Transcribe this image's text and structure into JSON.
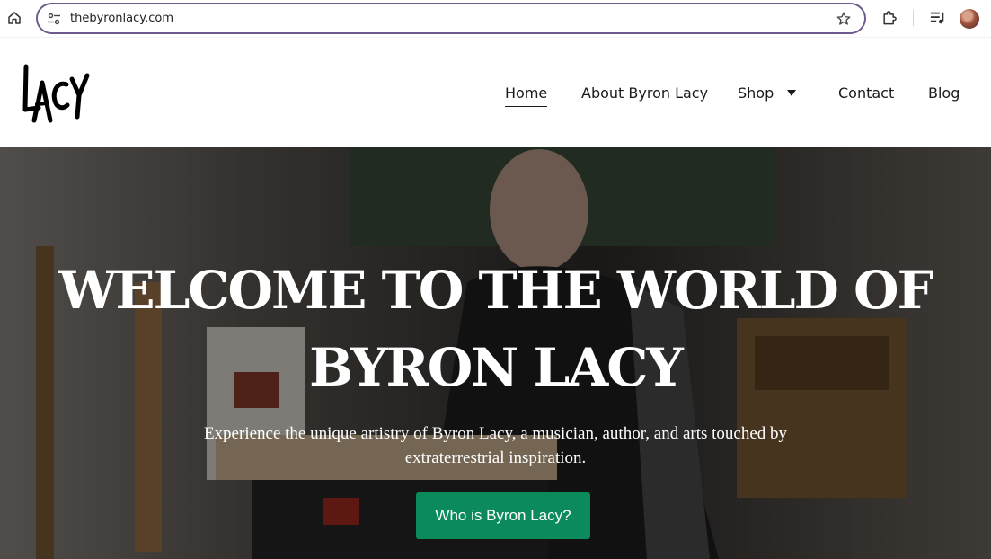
{
  "browser": {
    "url": "thebyronlacy.com",
    "icons": {
      "home": "home-icon",
      "site_settings": "tune-icon",
      "bookmark": "star-icon",
      "extensions": "puzzle-icon",
      "media": "media-queue-icon",
      "profile": "avatar"
    }
  },
  "site": {
    "logo_text": "LACY",
    "nav": [
      {
        "label": "Home",
        "active": true
      },
      {
        "label": "About Byron Lacy",
        "active": false
      },
      {
        "label": "Shop",
        "active": false,
        "has_dropdown": true
      },
      {
        "label": "Contact",
        "active": false
      },
      {
        "label": "Blog",
        "active": false
      }
    ]
  },
  "hero": {
    "title_line1": "WELCOME TO THE WORLD OF",
    "title_line2": "BYRON LACY",
    "subtitle": "Experience the unique artistry of Byron Lacy, a musician, author, and arts touched by extraterrestrial inspiration.",
    "cta_label": "Who is Byron Lacy?"
  },
  "colors": {
    "omnibox_border": "#6e5a8c",
    "cta_background": "#0b8a5c",
    "hero_text": "#ffffff"
  }
}
